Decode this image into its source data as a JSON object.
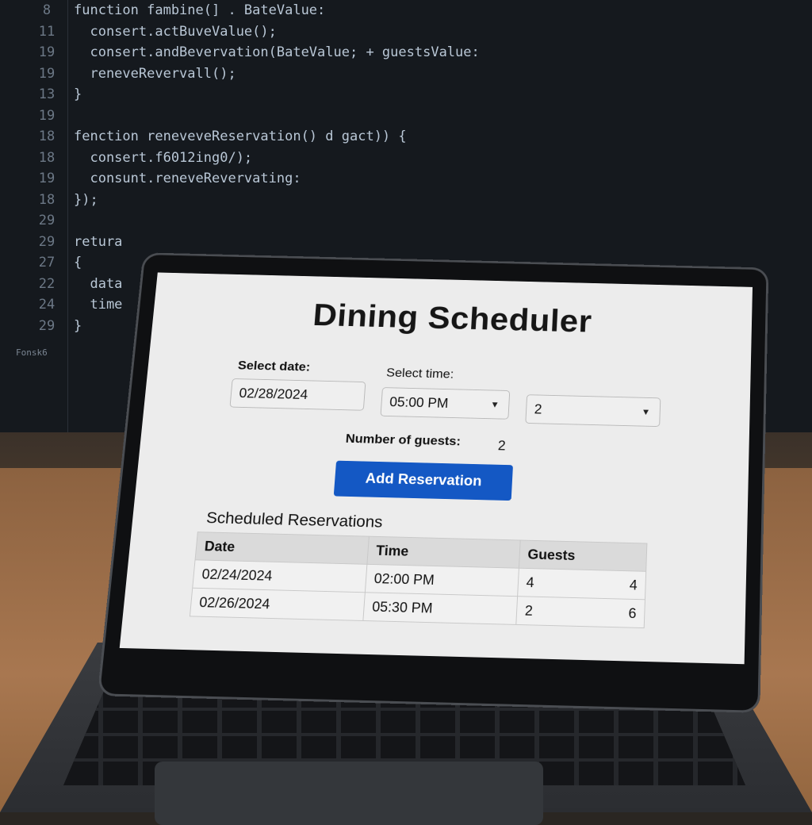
{
  "background_code": {
    "lines": [
      {
        "ln": "8",
        "text": "function fambine(] . BateValue:"
      },
      {
        "ln": "11",
        "text": "  consert.actBuveValue();"
      },
      {
        "ln": "19",
        "text": "  consert.andBevervation(BateValue; + guestsValue:"
      },
      {
        "ln": "19",
        "text": "  reneveRevervall();"
      },
      {
        "ln": "13",
        "text": "}"
      },
      {
        "ln": "19",
        "text": ""
      },
      {
        "ln": "18",
        "text": "fenction reneveveReservation() d gact)) {"
      },
      {
        "ln": "18",
        "text": "  consert.f6012ing0/);"
      },
      {
        "ln": "19",
        "text": "  consunt.reneveRevervating:"
      },
      {
        "ln": "18",
        "text": "});"
      },
      {
        "ln": "29",
        "text": ""
      },
      {
        "ln": "29",
        "text": "retura"
      },
      {
        "ln": "27",
        "text": "{"
      },
      {
        "ln": "22",
        "text": "  data"
      },
      {
        "ln": "24",
        "text": "  time"
      },
      {
        "ln": "29",
        "text": "}"
      }
    ],
    "status": "Fonsk6"
  },
  "app": {
    "title": "Dining Scheduler",
    "date_label": "Select date:",
    "date_value": "02/28/2024",
    "time_label": "Select time:",
    "time_value": "05:00 PM",
    "guests_select_value": "2",
    "guests_label": "Number of guests:",
    "guests_value": "2",
    "add_button": "Add Reservation",
    "section_title": "Scheduled Reservations",
    "table": {
      "headers": [
        "Date",
        "Time",
        "Guests"
      ],
      "rows": [
        {
          "date": "02/24/2024",
          "time": "02:00 PM",
          "guests": "4",
          "extra": "4"
        },
        {
          "date": "02/26/2024",
          "time": "05:30 PM",
          "guests": "2",
          "extra": "6"
        }
      ]
    }
  },
  "icons": {
    "dropdown": "chevron-down-icon"
  }
}
